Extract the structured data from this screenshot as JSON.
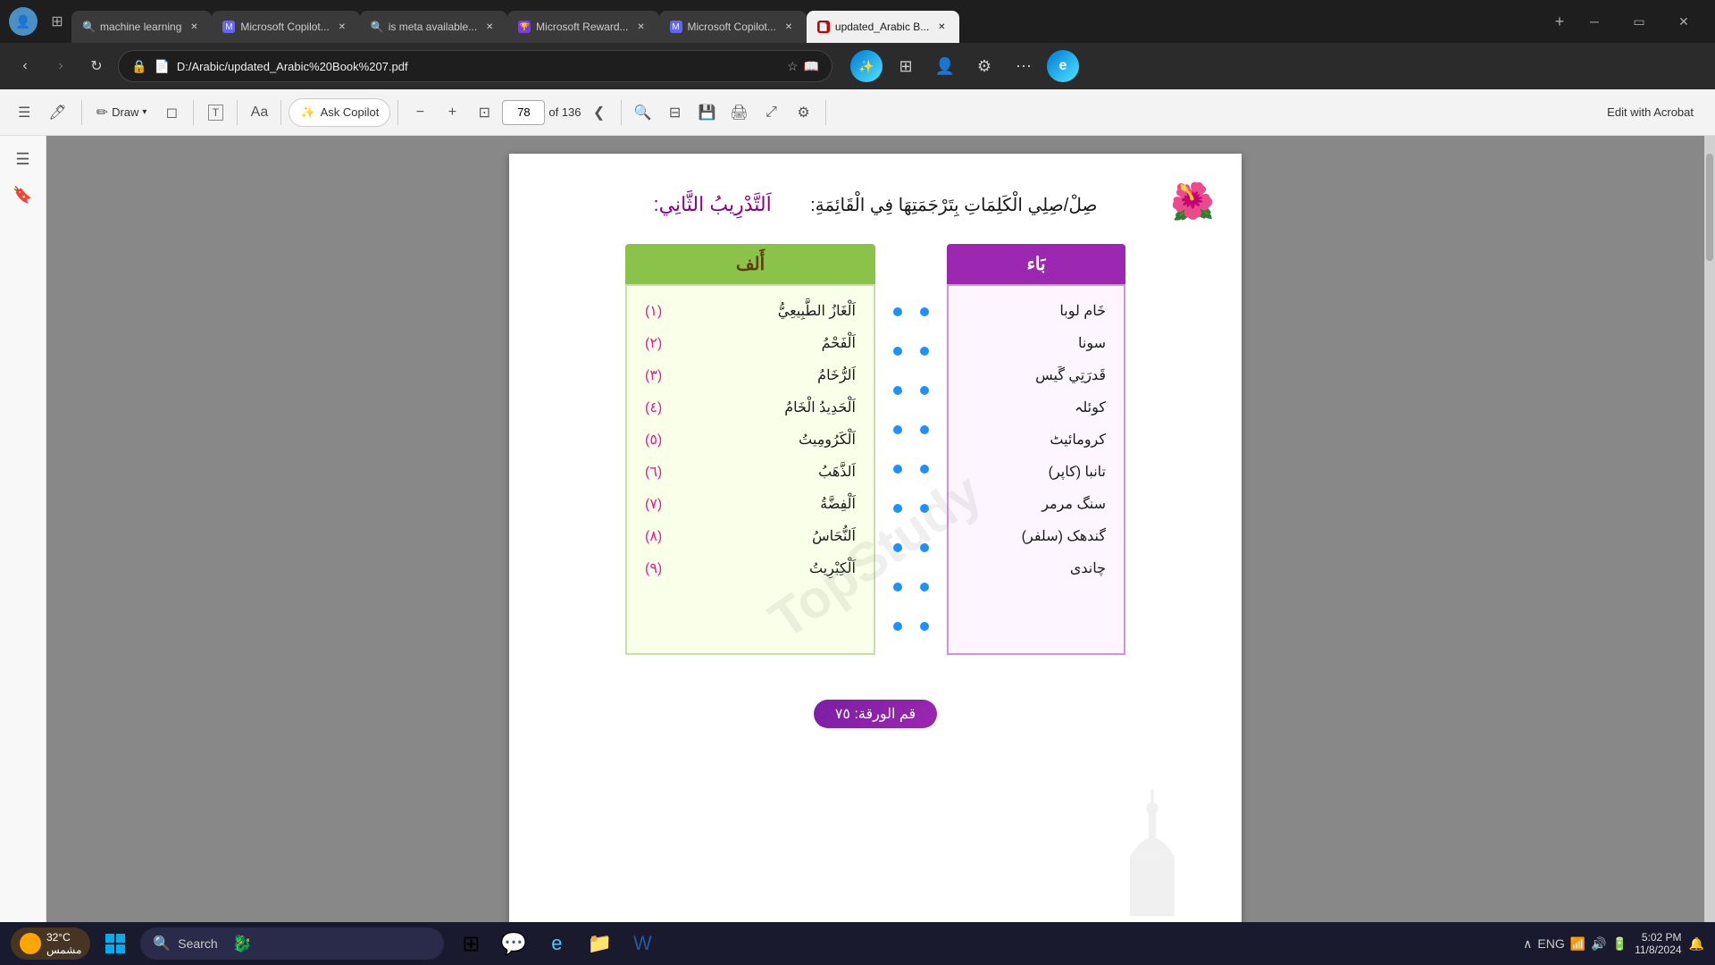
{
  "browser": {
    "tabs": [
      {
        "id": "tab1",
        "label": "machine learning",
        "active": false,
        "favicon": "🔍"
      },
      {
        "id": "tab2",
        "label": "Microsoft Copilot...",
        "active": false,
        "favicon": "Ⓜ"
      },
      {
        "id": "tab3",
        "label": "is meta available...",
        "active": false,
        "favicon": "🔍"
      },
      {
        "id": "tab4",
        "label": "Microsoft Reward...",
        "active": false,
        "favicon": "🏆"
      },
      {
        "id": "tab5",
        "label": "Microsoft Copilot...",
        "active": false,
        "favicon": "Ⓜ"
      },
      {
        "id": "tab6",
        "label": "updated_Arabic B...",
        "active": true,
        "favicon": "📄"
      }
    ],
    "address": "D:/Arabic/updated_Arabic%20Book%207.pdf",
    "title": "updated_Arabic Book 7.pdf"
  },
  "pdf_toolbar": {
    "tools": [
      "sidebar",
      "draw",
      "erase",
      "text",
      "fonts",
      "ask_copilot",
      "zoom_out",
      "zoom_in",
      "fit_page"
    ],
    "ask_copilot_label": "Ask Copilot",
    "current_page": "78",
    "total_pages": "of 136",
    "edit_acrobat": "Edit with Acrobat"
  },
  "page": {
    "exercise_title": "اَلتَّدْرِيبُ الثَّانِي:",
    "instruction": "صِلْ/صِلِي الْكَلِمَاتِ بِتَرْجَمَتِهَا فِي الْقَائِمَةِ:",
    "column_a_header": "أَلف",
    "column_b_header": "بَاء",
    "column_a_items": [
      {
        "num": "(١)",
        "text": "اَلْغَازُ الطَّبِيعِيُّ"
      },
      {
        "num": "(٢)",
        "text": "اَلْفَحْمُ"
      },
      {
        "num": "(٣)",
        "text": "اَلرُّخَامُ"
      },
      {
        "num": "(٤)",
        "text": "اَلْحَدِيدُ الْخَامُ"
      },
      {
        "num": "(٥)",
        "text": "اَلْكَرُومِيتُ"
      },
      {
        "num": "(٦)",
        "text": "اَلذَّهَبُ"
      },
      {
        "num": "(٧)",
        "text": "اَلْفِضَّةُ"
      },
      {
        "num": "(٨)",
        "text": "اَلنُّحَاسُ"
      },
      {
        "num": "(٩)",
        "text": "اَلْكِبْرِيتُ"
      }
    ],
    "column_b_items": [
      "خَام لوبا",
      "سونا",
      "قَدرَتِي گَيس",
      "کوئلہ",
      "کرومائيٹ",
      "تانبا (کاپر)",
      "سنگ مرمر",
      "گندھک (سلفر)",
      "چاندی"
    ],
    "watermark": "TopStudy",
    "page_number": "قم الورقة: ٧٥",
    "flower_emoji": "🌸"
  },
  "taskbar": {
    "search_placeholder": "Search",
    "weather_temp": "32°C",
    "weather_desc": "مشمس",
    "time": "5:02 PM",
    "date": "11/8/2024",
    "lang": "ENG"
  }
}
